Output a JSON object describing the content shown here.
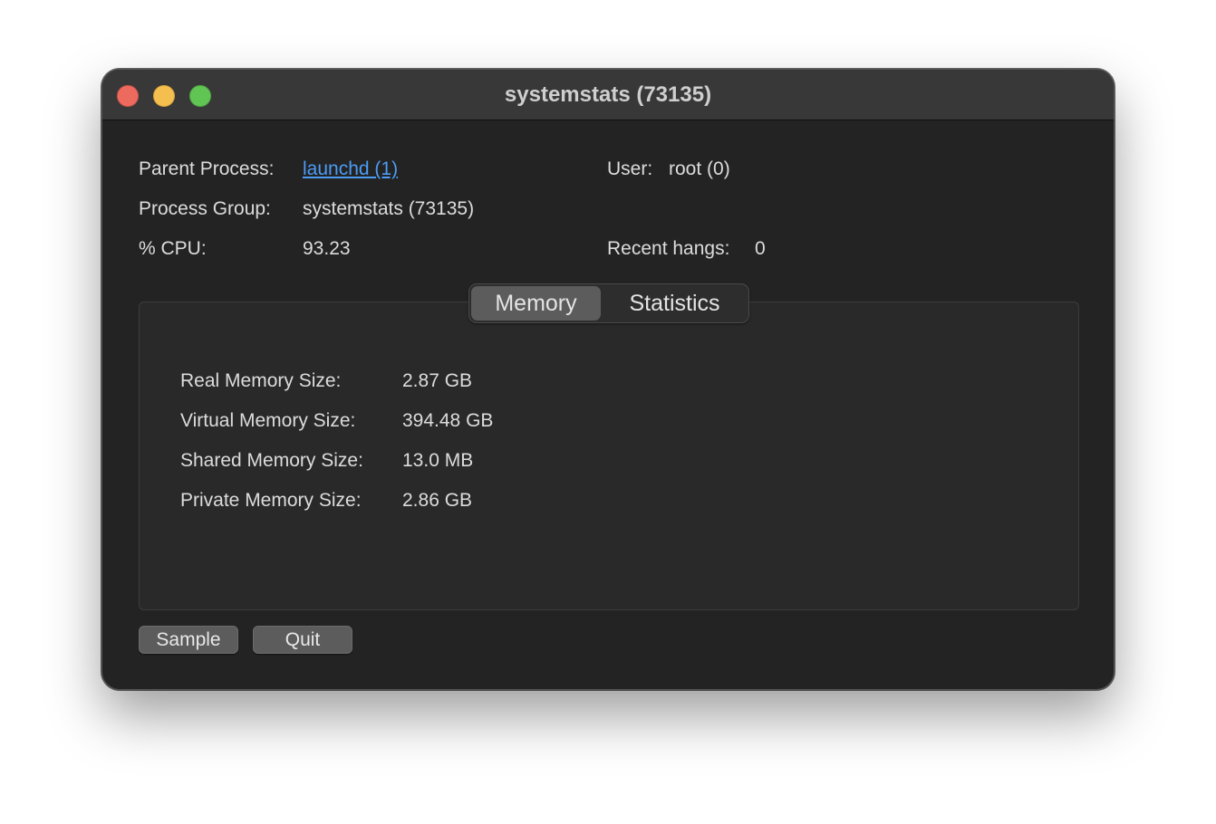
{
  "window": {
    "title": "systemstats (73135)"
  },
  "info": {
    "parent_process_label": "Parent Process:",
    "parent_process_value": "launchd (1)",
    "user_label": "User:",
    "user_value": "root (0)",
    "process_group_label": "Process Group:",
    "process_group_value": "systemstats (73135)",
    "cpu_label": "% CPU:",
    "cpu_value": "93.23",
    "recent_hangs_label": "Recent hangs:",
    "recent_hangs_value": "0"
  },
  "tabs": [
    {
      "label": "Memory",
      "active": true
    },
    {
      "label": "Statistics",
      "active": false
    }
  ],
  "memory": {
    "rows": [
      {
        "label": "Real Memory Size:",
        "value": "2.87 GB"
      },
      {
        "label": "Virtual Memory Size:",
        "value": "394.48 GB"
      },
      {
        "label": "Shared Memory Size:",
        "value": "13.0 MB"
      },
      {
        "label": "Private Memory Size:",
        "value": "2.86 GB"
      }
    ]
  },
  "buttons": {
    "sample": "Sample",
    "quit": "Quit"
  },
  "colors": {
    "window_bg": "#232323",
    "titlebar_bg": "#383838",
    "link": "#4c9cf5",
    "close": "#ed6a5e",
    "minimize": "#f5bf4f",
    "maximize": "#61c554"
  }
}
